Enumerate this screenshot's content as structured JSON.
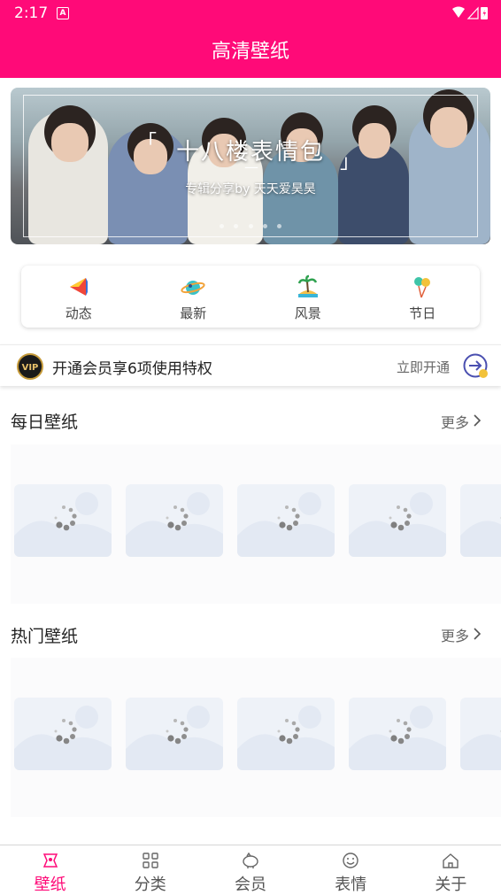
{
  "status": {
    "time": "2:17",
    "notif": "A"
  },
  "appbar": {
    "title": "高清壁纸"
  },
  "banner": {
    "title": "十八楼表情包",
    "subtitle": "专辑分享by 天天爱昊昊",
    "bracket_open": "「",
    "bracket_close": "」",
    "dash": "—"
  },
  "quick": {
    "items": [
      {
        "label": "动态",
        "icon": "megaphone-icon"
      },
      {
        "label": "最新",
        "icon": "planet-icon"
      },
      {
        "label": "风景",
        "icon": "island-icon"
      },
      {
        "label": "节日",
        "icon": "balloon-icon"
      }
    ]
  },
  "vip": {
    "badge": "VIP",
    "text": "开通会员享6项使用特权",
    "link": "立即开通"
  },
  "sections": [
    {
      "title": "每日壁纸",
      "more": "更多"
    },
    {
      "title": "热门壁纸",
      "more": "更多"
    }
  ],
  "tabbar": {
    "items": [
      {
        "label": "壁纸",
        "icon": "wallpaper-icon",
        "active": true
      },
      {
        "label": "分类",
        "icon": "grid-icon",
        "active": false
      },
      {
        "label": "会员",
        "icon": "piggy-bank-icon",
        "active": false
      },
      {
        "label": "表情",
        "icon": "smiley-icon",
        "active": false
      },
      {
        "label": "关于",
        "icon": "home-icon",
        "active": false
      }
    ]
  },
  "colors": {
    "brand": "#ff0a78",
    "text": "#222222"
  }
}
